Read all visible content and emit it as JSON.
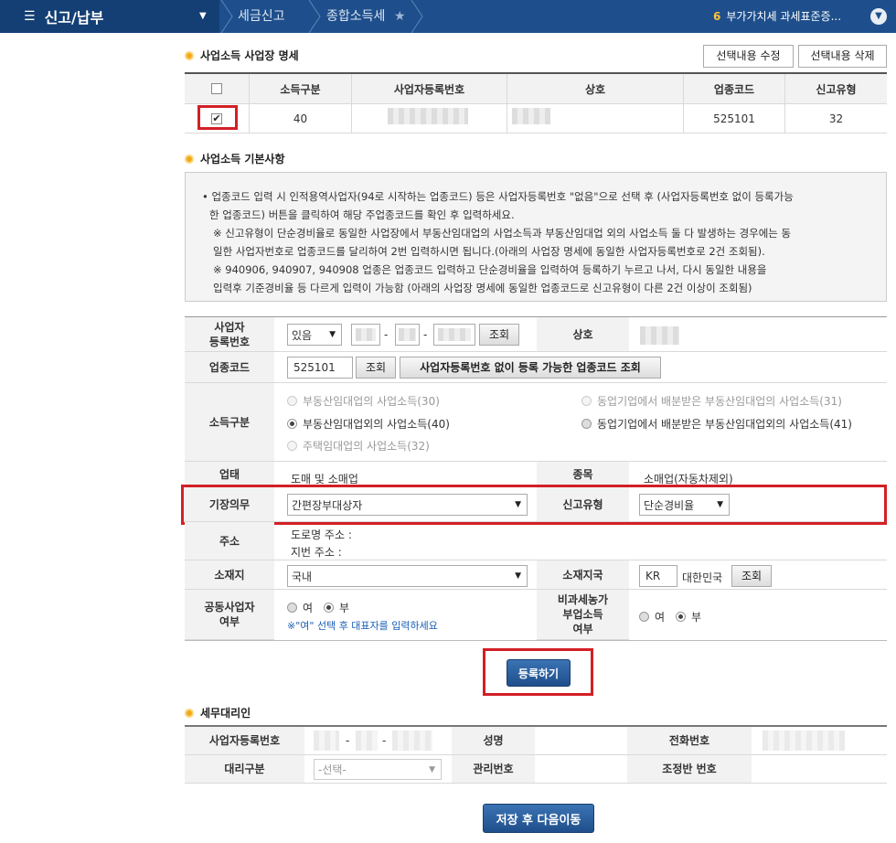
{
  "topbar": {
    "menu_label": "신고/납부",
    "crumbs": [
      "세금신고",
      "종합소득세"
    ],
    "notice_count": "6",
    "notice_text": "부가가치세 과세표준증..."
  },
  "business_list": {
    "title": "사업소득 사업장 명세",
    "edit_button": "선택내용 수정",
    "delete_button": "선택내용 삭제",
    "columns": [
      "소득구분",
      "사업자등록번호",
      "상호",
      "업종코드",
      "신고유형"
    ],
    "row": {
      "income_type": "40",
      "industry_code": "525101",
      "report_type": "32"
    }
  },
  "basic": {
    "title": "사업소득 기본사항",
    "notice_lines": [
      "• 업종코드 입력 시 인적용역사업자(94로 시작하는 업종코드) 등은 사업자등록번호 \"없음\"으로 선택 후 (사업자등록번호 없이 등록가능",
      "한 업종코드) 버튼을 클릭하여 해당 주업종코드를 확인 후 입력하세요.",
      "※ 신고유형이 단순경비율로 동일한 사업장에서 부동산임대업의 사업소득과 부동산임대업 외의 사업소득 둘 다 발생하는 경우에는 동",
      "일한 사업자번호로 업종코드를 달리하여 2번 입력하시면 됩니다.(아래의 사업장 명세에 동일한 사업자등록번호로 2건 조회됨).",
      "※ 940906, 940907, 940908 업종은 업종코드 입력하고 단순경비율을 입력하여 등록하기 누르고 나서, 다시 동일한 내용을",
      "입력후 기준경비율 등 다르게 입력이 가능함 (아래의 사업장 명세에 동일한 업종코드로 신고유형이 다른 2건 이상이 조회됨)"
    ]
  },
  "form": {
    "bizno_label": "사업자\n등록번호",
    "bizno_select": "있음",
    "lookup": "조회",
    "trade_name_label": "상호",
    "industry_label": "업종코드",
    "industry_value": "525101",
    "no_bizno_button": "사업자등록번호 없이 등록 가능한 업종코드 조회",
    "income_label": "소득구분",
    "income_options": [
      "부동산임대업의 사업소득(30)",
      "동업기업에서 배분받은 부동산임대업의 사업소득(31)",
      "부동산임대업외의 사업소득(40)",
      "동업기업에서 배분받은 부동산임대업외의 사업소득(41)",
      "주택임대업의 사업소득(32)"
    ],
    "business_type_label": "업태",
    "business_type_value": "도매 및 소매업",
    "item_label": "종목",
    "item_value": "소매업(자동차제외)",
    "bookkeeping_label": "기장의무",
    "bookkeeping_value": "간편장부대상자",
    "report_type_label": "신고유형",
    "report_type_value": "단순경비율",
    "address_label": "주소",
    "road_address": "도로명 주소 :",
    "lot_address": "지번 주소 :",
    "location_label": "소재지",
    "location_value": "국내",
    "country_label": "소재지국",
    "country_code": "KR",
    "country_name": "대한민국",
    "joint_label": "공동사업자\n여부",
    "yes": "여",
    "no": "부",
    "joint_hint": "※\"여\" 선택 후 대표자를 입력하세요",
    "nontax_label": "비과세농가\n부업소득\n여부",
    "register_button": "등록하기"
  },
  "agent": {
    "title": "세무대리인",
    "bizno_label": "사업자등록번호",
    "name_label": "성명",
    "phone_label": "전화번호",
    "agent_type_label": "대리구분",
    "agent_type_value": "-선택-",
    "manage_no_label": "관리번호",
    "adjust_no_label": "조정반 번호"
  },
  "save_next_button": "저장 후 다음이동"
}
